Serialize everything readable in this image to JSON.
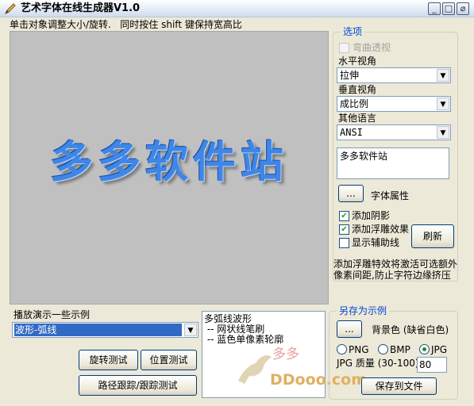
{
  "window": {
    "title": "艺术字体在线生成器V1.0",
    "hint": "单击对象调整大小/旋转.   同时按住 shift 键保持宽高比",
    "controls": [
      "_",
      "□",
      "⌀"
    ]
  },
  "canvas": {
    "art_text": "多多软件站",
    "background": "#c0c0c0",
    "text_color": "#3f86e6"
  },
  "options": {
    "legend": "选项",
    "warp_perspective": {
      "label": "弯曲透视",
      "checked": false,
      "enabled": false
    },
    "horizontal_view": {
      "label": "水平视角",
      "value": "拉伸"
    },
    "vertical_view": {
      "label": "垂直视角",
      "value": "成比例"
    },
    "other_language": {
      "label": "其他语言",
      "value": "ANSI"
    },
    "text_input": {
      "value": "多多软件站"
    },
    "font_button": "...",
    "font_props_label": "字体属性",
    "add_shadow": {
      "label": "添加阴影",
      "checked": true
    },
    "add_emboss": {
      "label": "添加浮雕效果",
      "checked": true
    },
    "show_guides": {
      "label": "显示辅助线",
      "checked": false
    },
    "refresh_button": "刷新",
    "note": "添加浮雕特效将激活可选额外像素间距,防止字符边缘挤压"
  },
  "demo": {
    "label": "播放演示一些示例",
    "selected": "波形-弧线",
    "description": [
      "多弧线波形",
      " -- 网状线笔刷",
      " -- 蓝色单像素轮廓"
    ],
    "rotate_test": "旋转测试",
    "position_test": "位置测试",
    "path_test": "路径跟踪/跟踪测试"
  },
  "save": {
    "legend": "另存为示例",
    "bg_button": "...",
    "bg_label": "背景色 (缺省白色)",
    "formats": [
      {
        "label": "PNG",
        "selected": false
      },
      {
        "label": "BMP",
        "selected": false
      },
      {
        "label": "JPG",
        "selected": true
      }
    ],
    "jpg_quality_label": "JPG 质量 (30-100)",
    "jpg_quality_value": "80",
    "save_button": "保存到文件"
  },
  "watermark": {
    "text": "多多",
    "url": "DDooo.com"
  },
  "colors": {
    "accent": "#0046d5",
    "selection": "#316ac5",
    "window_bg": "#ece9d8"
  }
}
